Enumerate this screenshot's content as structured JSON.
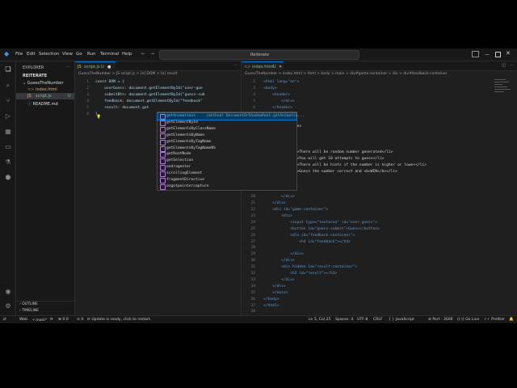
{
  "titlebar": {
    "menu": [
      "File",
      "Edit",
      "Selection",
      "View",
      "Go",
      "Run",
      "Terminal",
      "Help"
    ],
    "search": "Reiterate"
  },
  "sidebar": {
    "title": "EXPLORER",
    "project": "REITERATE",
    "folder": "GuessTheNumber",
    "files": [
      {
        "name": "index.html",
        "badge": ""
      },
      {
        "name": "script.js",
        "badge": "U"
      },
      {
        "name": "README.md",
        "badge": ""
      }
    ],
    "outline": "OUTLINE",
    "timeline": "TIMELINE"
  },
  "left_editor": {
    "tab": "script.js",
    "tab_badge": "U",
    "breadcrumb": "GuessTheNumber > JS script.js > [e] DOM > [e] result",
    "line_numbers": [
      "1",
      "2",
      "3",
      "4",
      "5",
      "6"
    ],
    "code": [
      "const DOM = {",
      "    userGuess: document.getElementById(\"user-gue",
      "    submitBtn: document.getElementById(\"guess-sub",
      "    feedback: document.getElementById(\"feedback\"",
      "    result: document.get",
      "}"
    ]
  },
  "suggestions": {
    "items": [
      "getAnimations",
      "getElementById",
      "getElementsByClassName",
      "getElementsByName",
      "getElementsByTagName",
      "getElementsByTagNameNS",
      "getRootNode",
      "getSelection",
      "ondragenter",
      "scrollingElement",
      "fragmentDirective",
      "ongotpointercapture"
    ],
    "selected_detail": "(method) DocumentOrShadowRoot.getAnimatio..."
  },
  "right_editor": {
    "tab": "index.html",
    "tab_badge": "U",
    "breadcrumb": "GuessTheNumber > index.html > html > body > main > div#game-container > div > div#feedback-container",
    "line_numbers": [
      "2",
      "3",
      "4",
      "5",
      "6",
      "7",
      "8",
      "9",
      "10",
      "11",
      "12",
      "13",
      "14",
      "15",
      "16",
      "17",
      "18",
      "19",
      "20",
      "21",
      "22",
      "23",
      "24",
      "25",
      "26",
      "27",
      "28",
      "29",
      "30",
      "31",
      "32",
      "33",
      "34",
      "35",
      "36",
      "37",
      "38",
      "39",
      "40",
      "41",
      "42",
      "43",
      "44",
      "45",
      "46"
    ],
    "code": [
      "<html lang=\"en\">",
      "<body>",
      "    <header>",
      "        </div>",
      "    </header>",
      "",
      "",
      "        The Rules",
      "        >",
      "        >",
      "        <ol>",
      "            <li>There will be random number generated</li>",
      "            <li>You will get 10 attempts to guess</li>",
      "            <li>There will be hints if the number is higher or lower</li>",
      "            <li>Guess the number correct and <b>WIN</b></li>",
      "        </ol>",
      "",
      "",
      "        </div>",
      "    </div>",
      "    <div id=\"game-container\">",
      "        <div>",
      "            <input type=\"textarea\" id=\"user-guess\">",
      "            <button id=\"guess-submit\">Guess</button>",
      "            <div id=\"feedback-container\">",
      "                <h4 id=\"feedback\"></h4>",
      "",
      "            </div>",
      "        </div>",
      "        <div hidden id=\"result-container\">",
      "            <h3 id=\"result\"></h3>",
      "        </div>",
      "    </div>",
      "    </main>",
      "</body>",
      "</html>"
    ]
  },
  "statusbar": {
    "left": [
      "Web",
      "main*",
      "0 0",
      "0",
      "Update is ready, click to restart."
    ],
    "right": [
      "Ln 5, Col 25",
      "Spaces: 4",
      "UTF-8",
      "CRLF",
      "JavaScript",
      "Port : 3000",
      "Go Live",
      "Prettier"
    ]
  }
}
